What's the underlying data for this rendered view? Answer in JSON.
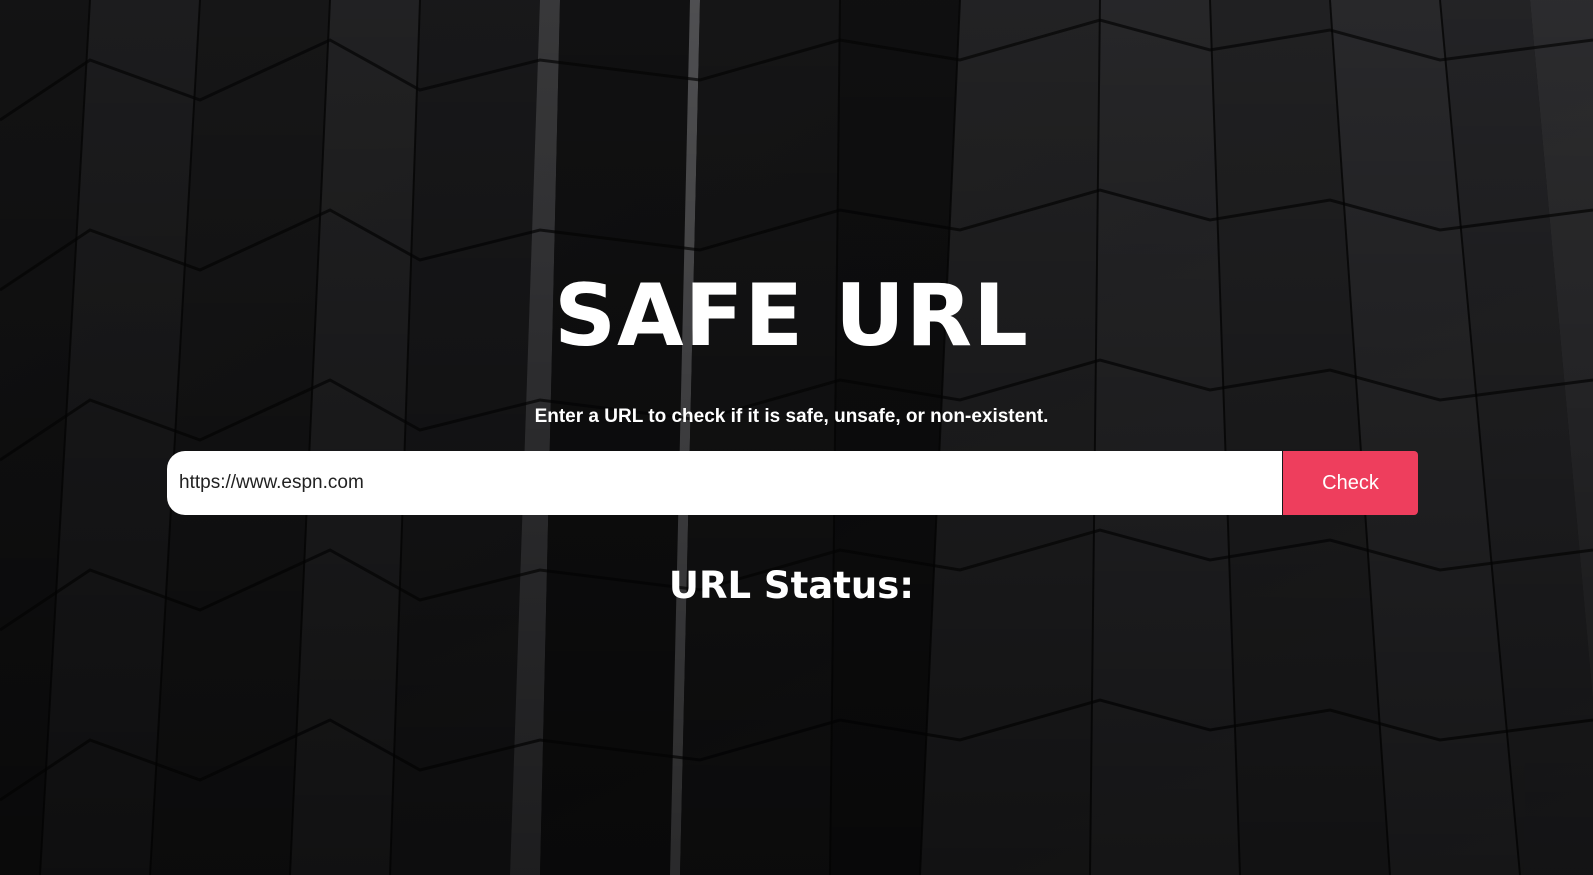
{
  "app": {
    "title": "SAFE URL",
    "subtitle": "Enter a URL to check if it is safe, unsafe, or non-existent."
  },
  "form": {
    "url_value": "https://www.espn.com",
    "check_label": "Check"
  },
  "status": {
    "heading": "URL Status:"
  },
  "colors": {
    "accent": "#ee3e5d",
    "background": "#0b0b0c",
    "text": "#ffffff"
  }
}
